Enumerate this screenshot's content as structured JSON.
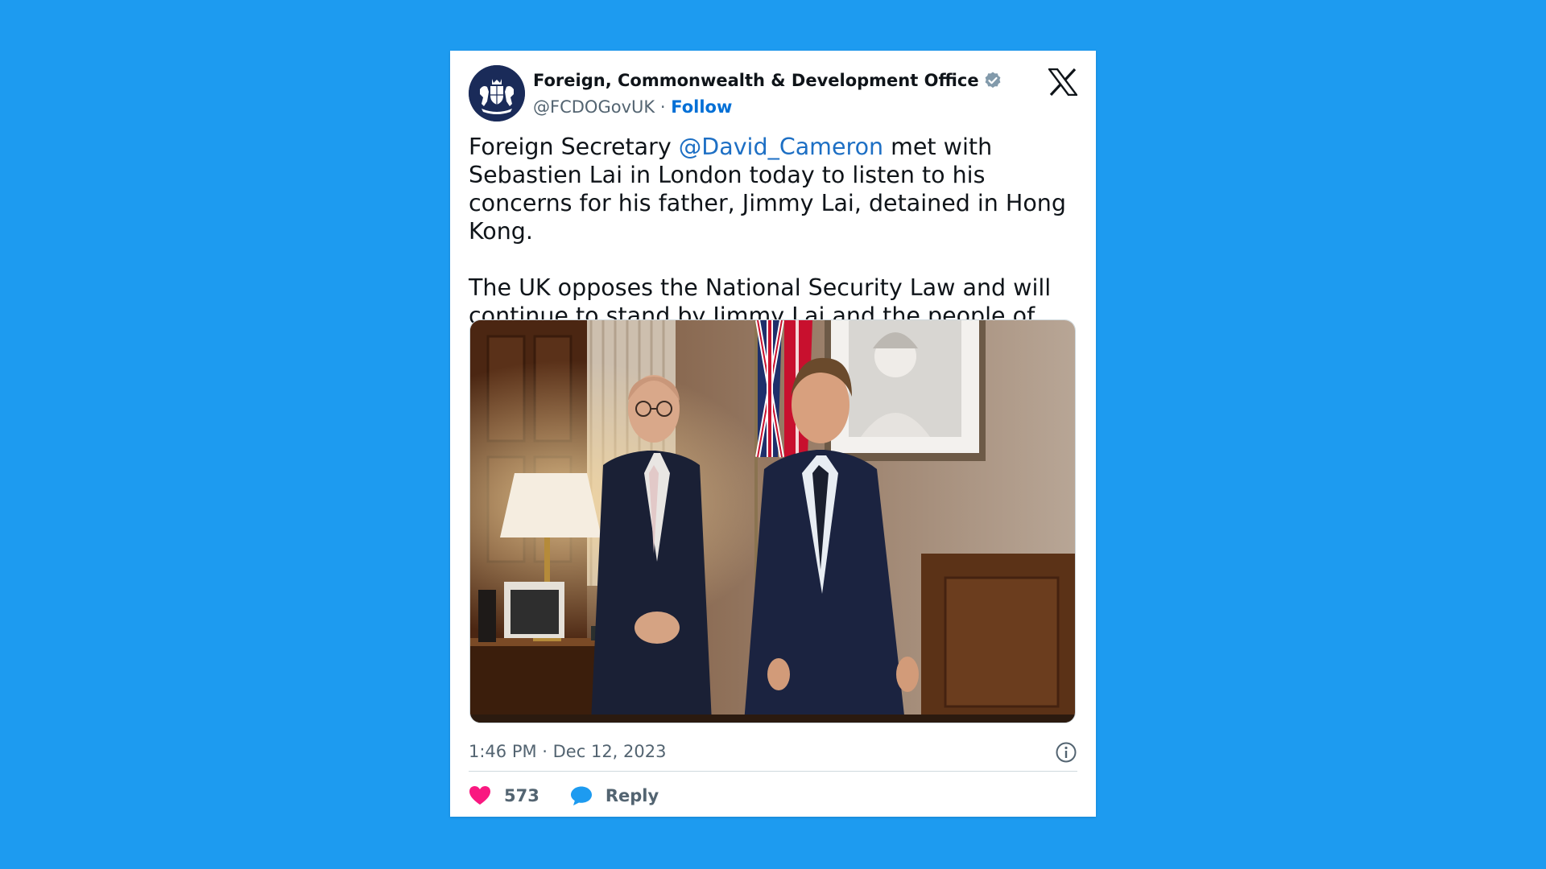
{
  "author": {
    "display_name": "Foreign, Commonwealth & Development Office",
    "handle": "@FCDOGovUK",
    "separator": "·",
    "follow_label": "Follow"
  },
  "tweet": {
    "text_part1": "Foreign Secretary ",
    "mention": "@David_Cameron",
    "text_part2": " met with Sebastien Lai in London today to listen to his concerns for his father, Jimmy Lai, detained in Hong Kong.",
    "paragraph2": "The UK opposes the National Security Law and will continue to stand by Jimmy Lai and the people of HK.",
    "timestamp": "1:46 PM · Dec 12, 2023"
  },
  "engagement": {
    "likes": "573",
    "reply_label": "Reply"
  },
  "icons": {
    "avatar": "royal-coat-of-arms",
    "verified": "verified-badge-icon",
    "logo": "x-logo-icon",
    "info": "info-icon",
    "like": "heart-icon",
    "reply": "speech-bubble-icon"
  },
  "colors": {
    "background": "#1d9bf0",
    "link": "#1d6fc4",
    "follow": "#006fd6",
    "heart": "#f91880",
    "reply_bubble": "#1d9bf0",
    "avatar_bg": "#1a2b59"
  }
}
